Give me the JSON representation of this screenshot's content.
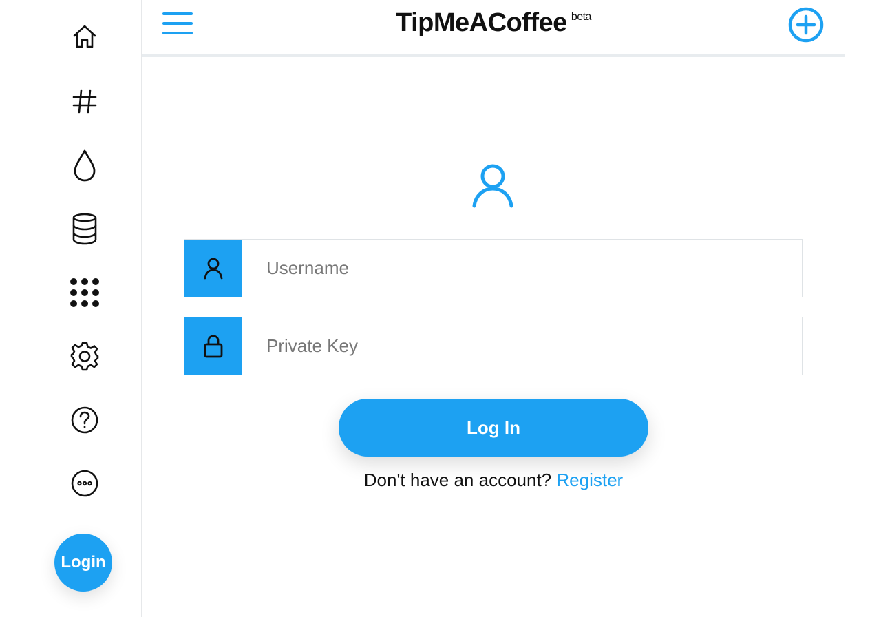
{
  "app": {
    "title": "TipMeACoffee",
    "badge": "beta",
    "accent_color": "#1da1f2"
  },
  "sidebar": {
    "items": [
      {
        "icon": "home-icon"
      },
      {
        "icon": "hashtag-icon"
      },
      {
        "icon": "drop-icon"
      },
      {
        "icon": "database-icon"
      },
      {
        "icon": "dots-grid-icon"
      },
      {
        "icon": "gear-icon"
      },
      {
        "icon": "help-circle-icon"
      },
      {
        "icon": "more-circle-icon"
      }
    ],
    "login_label": "Login"
  },
  "header": {
    "menu_icon": "hamburger-icon",
    "add_icon": "plus-circle-icon"
  },
  "login_form": {
    "avatar_icon": "user-icon",
    "username": {
      "placeholder": "Username",
      "value": "",
      "icon": "user-icon"
    },
    "private_key": {
      "placeholder": "Private Key",
      "value": "",
      "icon": "lock-icon"
    },
    "submit_label": "Log In",
    "register_prompt": "Don't have an account?",
    "register_link": "Register"
  }
}
